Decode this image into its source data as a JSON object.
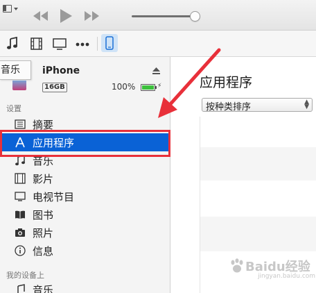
{
  "toolbar": {
    "window_menu_icon": "window-menu-icon",
    "controls": [
      "rewind-icon",
      "play-icon",
      "fast-forward-icon"
    ],
    "volume_level": 0.88
  },
  "media_bar": {
    "items": [
      "music-note-icon",
      "film-icon",
      "tv-icon",
      "more-icon",
      "iphone-icon"
    ]
  },
  "tooltip": {
    "text": "音乐"
  },
  "device": {
    "name": "iPhone",
    "capacity": "16GB",
    "battery": "100%",
    "battery_level": 1.0,
    "eject_icon": "eject-icon"
  },
  "sidebar": {
    "settings_header": "设置",
    "items": [
      {
        "label": "摘要",
        "icon": "summary-icon"
      },
      {
        "label": "应用程序",
        "icon": "apps-icon",
        "selected": true
      },
      {
        "label": "音乐",
        "icon": "music-note-icon"
      },
      {
        "label": "影片",
        "icon": "film-icon"
      },
      {
        "label": "电视节目",
        "icon": "tv-icon"
      },
      {
        "label": "图书",
        "icon": "book-icon"
      },
      {
        "label": "照片",
        "icon": "camera-icon"
      },
      {
        "label": "信息",
        "icon": "info-icon"
      }
    ],
    "my_device_header": "我的设备上",
    "device_items": [
      {
        "label": "音乐",
        "icon": "music-note-icon"
      }
    ]
  },
  "main": {
    "title": "应用程序",
    "sort": {
      "selected": "按种类排序"
    }
  },
  "watermark": {
    "text": "Baidu经验",
    "sub": "jingyan.baidu.com"
  },
  "colors": {
    "selection": "#0a62d6",
    "annotation_red": "#e8303a",
    "battery_green": "#3cc13c",
    "device_button_bg": "#cfe3f7"
  }
}
